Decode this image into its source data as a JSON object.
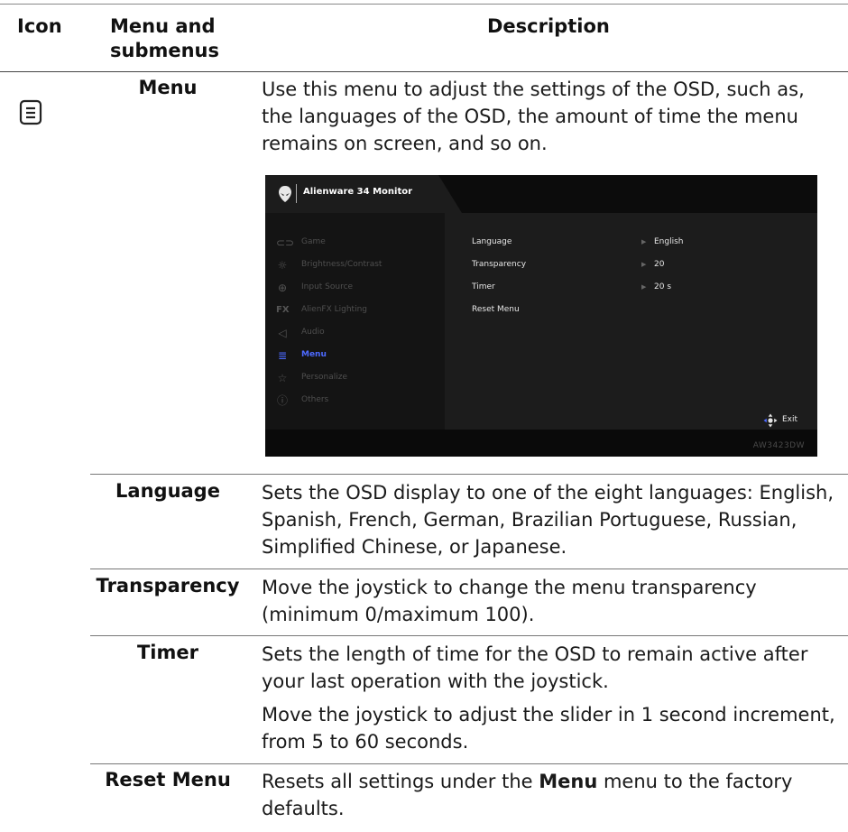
{
  "header": {
    "col_icon": "Icon",
    "col_menu": "Menu and submenus",
    "col_desc": "Description"
  },
  "rows": {
    "menu": {
      "label": "Menu",
      "desc": "Use this menu to adjust the settings of the OSD, such as, the languages of the OSD, the amount of time the menu remains on screen, and so on."
    },
    "language": {
      "label": "Language",
      "desc": "Sets the OSD display to one of the eight languages: English, Spanish, French, German, Brazilian Portuguese, Russian, Simplified Chinese, or Japanese."
    },
    "transparency": {
      "label": "Transparency",
      "desc": "Move the joystick to change the menu transparency (minimum 0/maximum 100)."
    },
    "timer": {
      "label": "Timer",
      "desc1": "Sets the length of time for the OSD to remain active after your last operation with the joystick.",
      "desc2": "Move the joystick to adjust the slider in 1 second increment, from 5 to 60 seconds."
    },
    "reset": {
      "label": "Reset Menu",
      "desc_pre": "Resets all settings under the ",
      "desc_bold": "Menu",
      "desc_post": " menu to the factory defaults."
    }
  },
  "osd": {
    "title": "Alienware 34 Monitor",
    "model": "AW3423DW",
    "exit_label": "Exit",
    "menu_items": [
      {
        "label": "Game",
        "icon": "gamepad-icon"
      },
      {
        "label": "Brightness/Contrast",
        "icon": "brightness-icon"
      },
      {
        "label": "Input Source",
        "icon": "input-source-icon"
      },
      {
        "label": "AlienFX Lighting",
        "icon": "fx-icon"
      },
      {
        "label": "Audio",
        "icon": "speaker-icon"
      },
      {
        "label": "Menu",
        "icon": "menu-icon",
        "active": true
      },
      {
        "label": "Personalize",
        "icon": "star-icon"
      },
      {
        "label": "Others",
        "icon": "info-icon"
      }
    ],
    "settings": [
      {
        "label": "Language",
        "value": "English"
      },
      {
        "label": "Transparency",
        "value": "20"
      },
      {
        "label": "Timer",
        "value": "20 s"
      },
      {
        "label": "Reset Menu",
        "value": ""
      }
    ],
    "colors": {
      "active": "#4d6aff",
      "panel": "#1c1c1c",
      "sidebar": "#141414"
    }
  }
}
